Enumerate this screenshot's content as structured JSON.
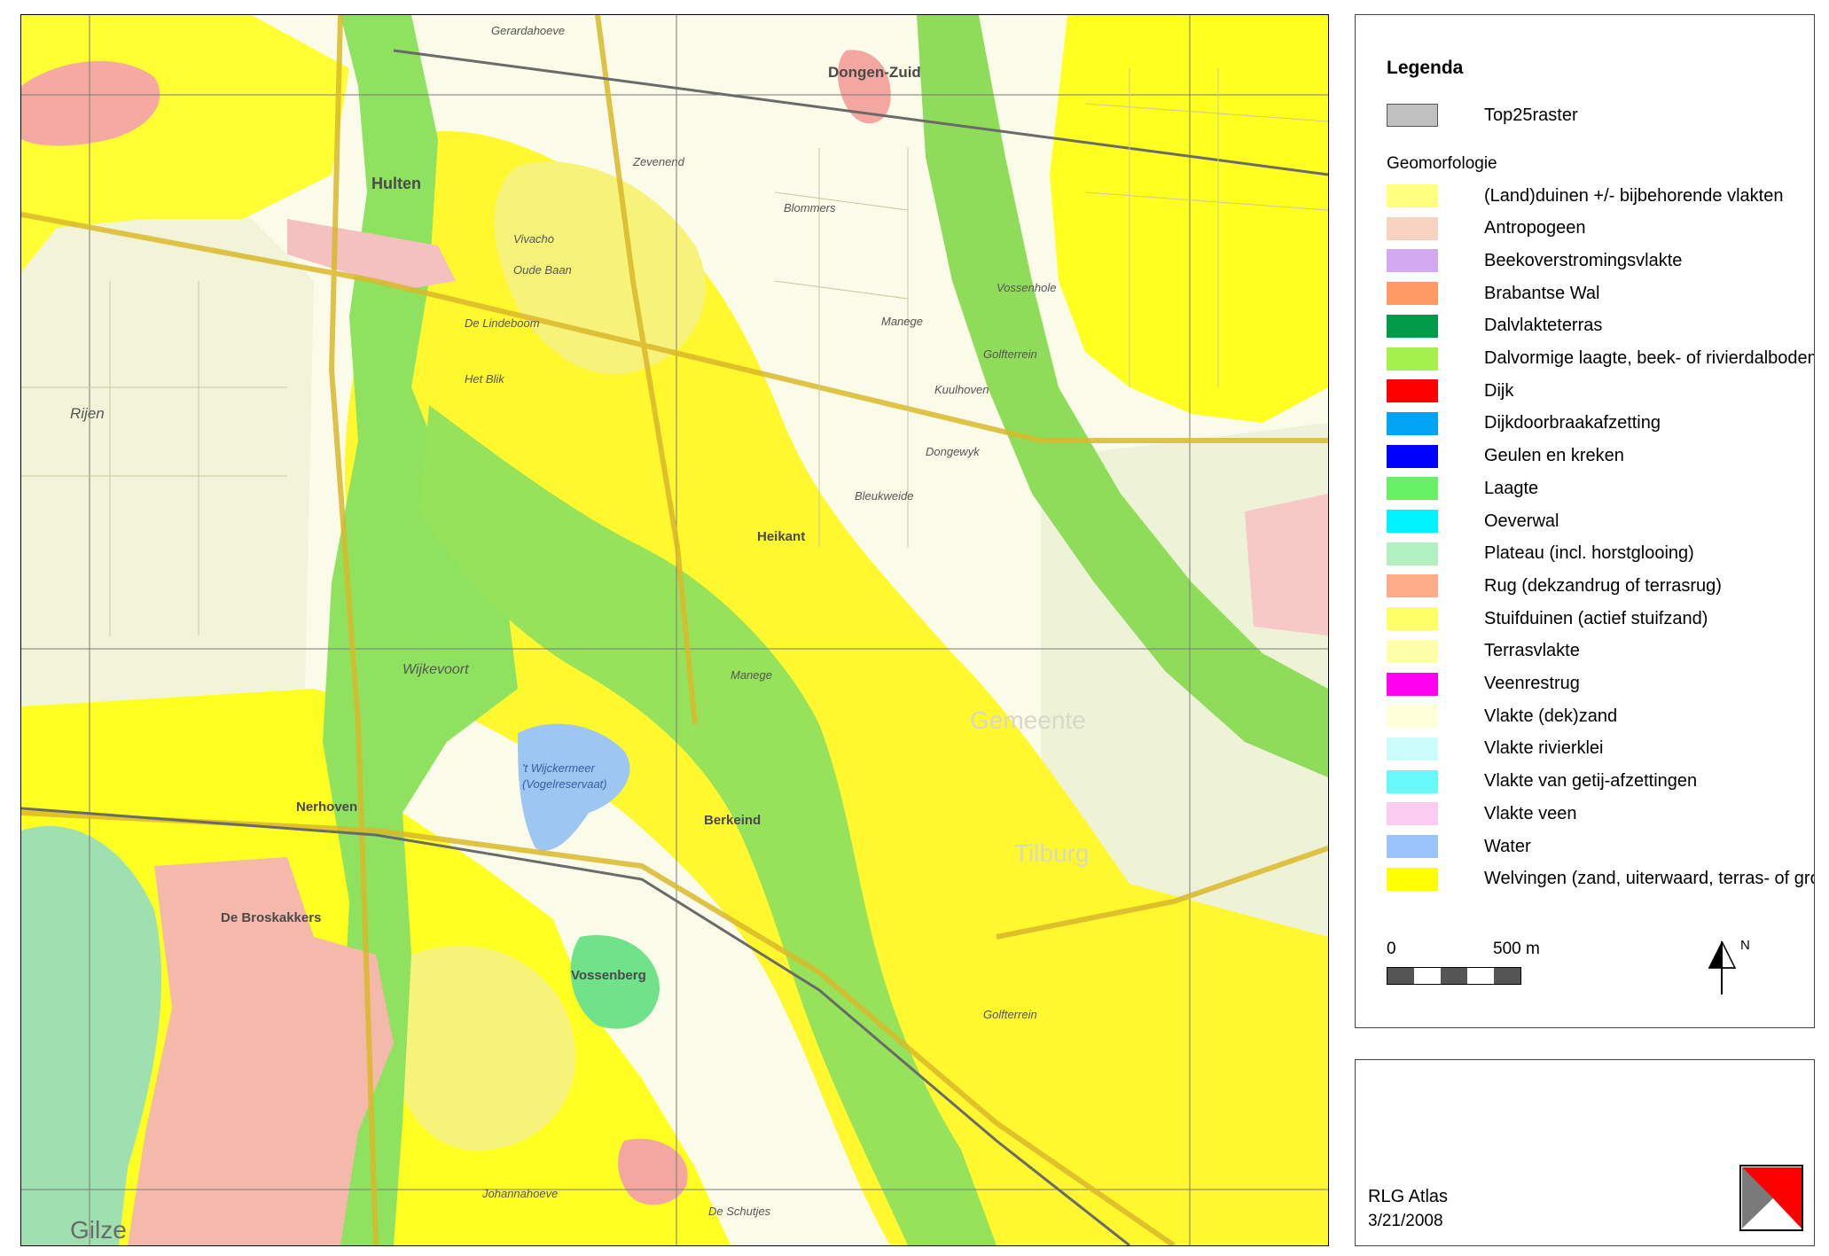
{
  "legend": {
    "title": "Legenda",
    "top25": "Top25raster",
    "subtitle": "Geomorfologie",
    "items": [
      {
        "label": "(Land)duinen +/- bijbehorende vlakten",
        "color": "#ffff80"
      },
      {
        "label": "Antropogeen",
        "color": "#f9d3c2"
      },
      {
        "label": "Beekoverstromingsvlakte",
        "color": "#d3a9f2"
      },
      {
        "label": "Brabantse Wal",
        "color": "#ff9966"
      },
      {
        "label": "Dalvlakteterras",
        "color": "#009a48"
      },
      {
        "label": "Dalvormige laagte, beek- of rivierdalbodem",
        "color": "#a4f04c"
      },
      {
        "label": "Dijk",
        "color": "#ff0000"
      },
      {
        "label": "Dijkdoorbraakafzetting",
        "color": "#00a4f2"
      },
      {
        "label": "Geulen en kreken",
        "color": "#0000ff"
      },
      {
        "label": "Laagte",
        "color": "#66f066"
      },
      {
        "label": "Oeverwal",
        "color": "#00f4ff"
      },
      {
        "label": "Plateau (incl. horstglooing)",
        "color": "#b2f0c2"
      },
      {
        "label": "Rug (dekzandrug of terrasrug)",
        "color": "#ffaa88"
      },
      {
        "label": "Stuifduinen (actief stuifzand)",
        "color": "#ffff66"
      },
      {
        "label": "Terrasvlakte",
        "color": "#ffffaa"
      },
      {
        "label": "Veenrestrug",
        "color": "#ff00f0"
      },
      {
        "label": "Vlakte (dek)zand",
        "color": "#ffffd8"
      },
      {
        "label": "Vlakte rivierklei",
        "color": "#ccfcfa"
      },
      {
        "label": "Vlakte van getij-afzettingen",
        "color": "#66fafa"
      },
      {
        "label": "Vlakte veen",
        "color": "#fccbf2"
      },
      {
        "label": "Water",
        "color": "#99c4fa"
      },
      {
        "label": "Welvingen (zand, uiterwaard, terras- of grondmorenewelving)",
        "color": "#ffff00"
      }
    ]
  },
  "scale": {
    "zero": "0",
    "distance": "500 m",
    "north": "N"
  },
  "footer": {
    "atlas": "RLG Atlas",
    "date": "3/21/2008"
  },
  "map": {
    "labels": {
      "hulten": "Hulten",
      "gemeente": "Gemeente",
      "tilburg": "Tilburg",
      "gilze": "Gilze",
      "heikant": "Heikant",
      "berkeind": "Berkeind",
      "vossenberg": "Vossenberg",
      "wijkevoort": "Wijkevoort",
      "nerhoven": "Nerhoven",
      "broskakkers": "De Broskakkers",
      "dongen_zuid": "Dongen-Zuid",
      "blommers": "Blommers",
      "de_lindeboom": "De Lindeboom",
      "het_blik": "Het Blik",
      "bleukweide": "Bleukweide",
      "dongewyk": "Dongewyk",
      "manege1": "Manege",
      "manege2": "Manege",
      "golfterrein1": "Golfterrein",
      "golfterrein2": "Golfterrein",
      "de_schutjes": "De Schutjes",
      "johannahoeve": "Johannahoeve",
      "zevenend": "Zevenend",
      "vivacho": "Vivacho",
      "oude_baan": "Oude Baan",
      "vossenhole": "Vossenhole",
      "kuulhoven": "Kuulhoven",
      "wijckermeer": "'t Wijckermeer",
      "vogelreservaat": "(Vogelreservaat)",
      "gerardahoeve": "Gerardahoeve",
      "rijen": "Rijen"
    },
    "colors": {
      "base": "#fbfbe9",
      "welving": "#ffff00",
      "landduinen": "#fbf76a",
      "laagte": "#8fe35a",
      "dalbodem": "#a4ec4c",
      "antropogeen": "#f5b9b0",
      "plateau": "#9fe8b6",
      "water": "#9dc6f3",
      "terrasvlakte": "#f8f8c8",
      "vlakte_zand": "#fdfde4",
      "grid": "#7f7f7f",
      "road": "#e6c12a"
    }
  }
}
